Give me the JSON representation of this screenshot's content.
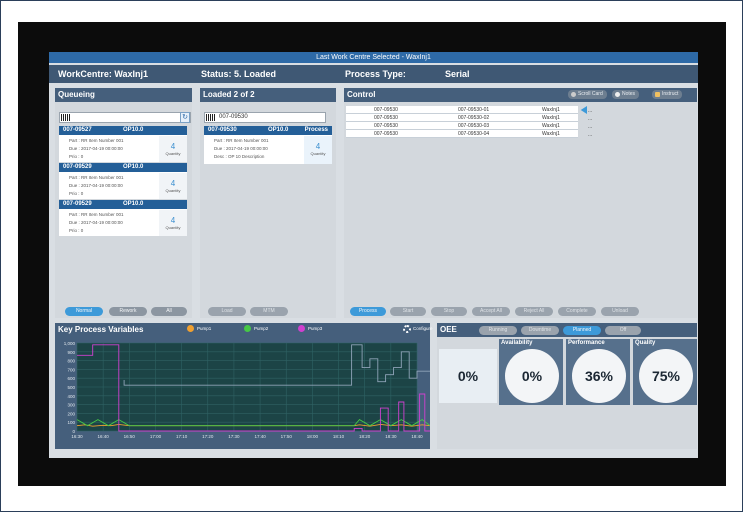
{
  "window_title": "Last Work Centre Selected - WaxInj1",
  "header": {
    "workcentre": "WorkCentre: WaxInj1",
    "status": "Status: 5. Loaded",
    "process_type_label": "Process Type:",
    "process_type_value": "Serial"
  },
  "queueing": {
    "title": "Queueing",
    "cards": [
      {
        "order": "007-09527",
        "op": "OP10.0",
        "part": "Part :  RR Item Number 001",
        "due": "Due :  2017-04-19 00:00:00",
        "prio": "Prio :  0",
        "qty": "4",
        "qty_label": "Quantity"
      },
      {
        "order": "007-09529",
        "op": "OP10.0",
        "part": "Part :  RR Item Number 001",
        "due": "Due :  2017-04-19 00:00:00",
        "prio": "Prio :  0",
        "qty": "4",
        "qty_label": "Quantity"
      },
      {
        "order": "007-09529",
        "op": "OP10.0",
        "part": "Part :  RR Item Number 001",
        "due": "Due :  2017-04-19 00:00:00",
        "prio": "Prio :  0",
        "qty": "4",
        "qty_label": "Quantity"
      }
    ],
    "buttons": {
      "normal": "Normal",
      "rework": "Rework",
      "all": "All"
    }
  },
  "loaded": {
    "title": "Loaded   2   of   2",
    "search_value": "007-09530",
    "card": {
      "order": "007-09530",
      "op": "OP10.0",
      "tag": "Process",
      "part": "Part :  RR Item Number 001",
      "due": "Due :  2017-04-19 00:00:00",
      "desc": "Desc :  OP 10 Description",
      "qty": "4",
      "qty_label": "Quantity"
    },
    "buttons": {
      "load": "Load",
      "mtm": "MTM"
    }
  },
  "control": {
    "title": "Control",
    "toolbar": {
      "scroll_card": "Scroll Card",
      "notes": "Notes",
      "instruct": "Instruct"
    },
    "rows": [
      {
        "c1": "007-09530",
        "c2": "007-09530-01",
        "c3": "WaxInj1",
        "c4": "..."
      },
      {
        "c1": "007-09530",
        "c2": "007-09530-02",
        "c3": "WaxInj1",
        "c4": "..."
      },
      {
        "c1": "007-09530",
        "c2": "007-09530-03",
        "c3": "WaxInj1",
        "c4": "..."
      },
      {
        "c1": "007-09530",
        "c2": "007-09530-04",
        "c3": "WaxInj1",
        "c4": "..."
      }
    ],
    "buttons": {
      "process": "Process",
      "start": "Start",
      "stop": "Stop",
      "accept_all": "Accept All",
      "reject_all": "Reject All",
      "complete": "Complete",
      "unload": "Unload"
    }
  },
  "kpv": {
    "title": "Key Process Variables",
    "configure": "Configure",
    "legend": [
      {
        "name": "Pump1",
        "color": "#f0a030"
      },
      {
        "name": "Pump2",
        "color": "#46c846"
      },
      {
        "name": "Pump3",
        "color": "#d040d0"
      }
    ]
  },
  "oee": {
    "title": "OEE",
    "tabs": {
      "running": "Running",
      "downtime": "Downtime",
      "planned": "Planned",
      "off": "Off"
    },
    "total": "0%",
    "availability_label": "Availability",
    "availability": "0%",
    "performance_label": "Performance",
    "performance": "36%",
    "quality_label": "Quality",
    "quality": "75%"
  },
  "chart_data": {
    "type": "line",
    "title": "",
    "ylim": [
      0,
      1000
    ],
    "yticks": [
      "1,000",
      "900",
      "800",
      "700",
      "600",
      "500",
      "400",
      "300",
      "200",
      "100",
      "0"
    ],
    "xticks": [
      "16:30",
      "16:40",
      "16:50",
      "17:00",
      "17:10",
      "17:20",
      "17:30",
      "17:40",
      "17:50",
      "18:00",
      "18:10",
      "18:20",
      "18:30",
      "18:40"
    ],
    "grid": true,
    "series": [
      {
        "name": "Pump1",
        "color": "#f0a030",
        "points": [
          [
            0,
            60
          ],
          [
            0.3,
            70
          ],
          [
            0.6,
            55
          ],
          [
            1,
            65
          ],
          [
            1.3,
            60
          ],
          [
            1.6,
            75
          ],
          [
            2,
            60
          ],
          [
            2,
            60
          ],
          [
            10.6,
            60
          ],
          [
            10.8,
            70
          ],
          [
            11.2,
            55
          ],
          [
            11.6,
            75
          ],
          [
            12,
            60
          ],
          [
            12.4,
            70
          ],
          [
            12.8,
            55
          ],
          [
            13.2,
            70
          ],
          [
            13.5,
            60
          ]
        ]
      },
      {
        "name": "Pump2",
        "color": "#46c846",
        "points": [
          [
            0,
            130
          ],
          [
            0.4,
            60
          ],
          [
            0.8,
            130
          ],
          [
            1.2,
            60
          ],
          [
            1.6,
            130
          ],
          [
            2,
            60
          ],
          [
            2,
            60
          ],
          [
            10.6,
            60
          ],
          [
            10.8,
            130
          ],
          [
            11.2,
            60
          ],
          [
            11.6,
            130
          ],
          [
            12,
            60
          ],
          [
            12.4,
            130
          ],
          [
            12.8,
            60
          ],
          [
            13.2,
            130
          ],
          [
            13.5,
            60
          ]
        ]
      },
      {
        "name": "Pump3",
        "color": "#d040d0",
        "points": [
          [
            0,
            860
          ],
          [
            0.6,
            860
          ],
          [
            0.6,
            980
          ],
          [
            1.6,
            980
          ],
          [
            1.6,
            0
          ],
          [
            2,
            0
          ],
          [
            2,
            0
          ],
          [
            10.6,
            0
          ],
          [
            10.6,
            30
          ],
          [
            10.9,
            30
          ],
          [
            10.9,
            0
          ],
          [
            11.6,
            0
          ],
          [
            11.6,
            260
          ],
          [
            11.9,
            260
          ],
          [
            11.9,
            0
          ],
          [
            12.3,
            0
          ],
          [
            12.3,
            330
          ],
          [
            12.5,
            330
          ],
          [
            12.5,
            0
          ],
          [
            13.1,
            0
          ],
          [
            13.1,
            420
          ],
          [
            13.3,
            420
          ],
          [
            13.3,
            0
          ],
          [
            13.5,
            0
          ]
        ]
      },
      {
        "name": "",
        "color": "#8fa3b8",
        "points": [
          [
            1.8,
            580
          ],
          [
            1.8,
            520
          ],
          [
            10.5,
            520
          ],
          [
            10.5,
            980
          ],
          [
            10.9,
            980
          ],
          [
            10.9,
            720
          ],
          [
            11.2,
            720
          ],
          [
            11.2,
            820
          ],
          [
            11.5,
            820
          ],
          [
            11.5,
            560
          ],
          [
            11.8,
            560
          ],
          [
            11.8,
            640
          ],
          [
            12.1,
            640
          ],
          [
            12.1,
            720
          ],
          [
            12.4,
            720
          ],
          [
            12.4,
            900
          ],
          [
            12.7,
            900
          ],
          [
            12.7,
            600
          ],
          [
            13,
            600
          ],
          [
            13,
            680
          ],
          [
            13.5,
            680
          ]
        ]
      }
    ]
  }
}
